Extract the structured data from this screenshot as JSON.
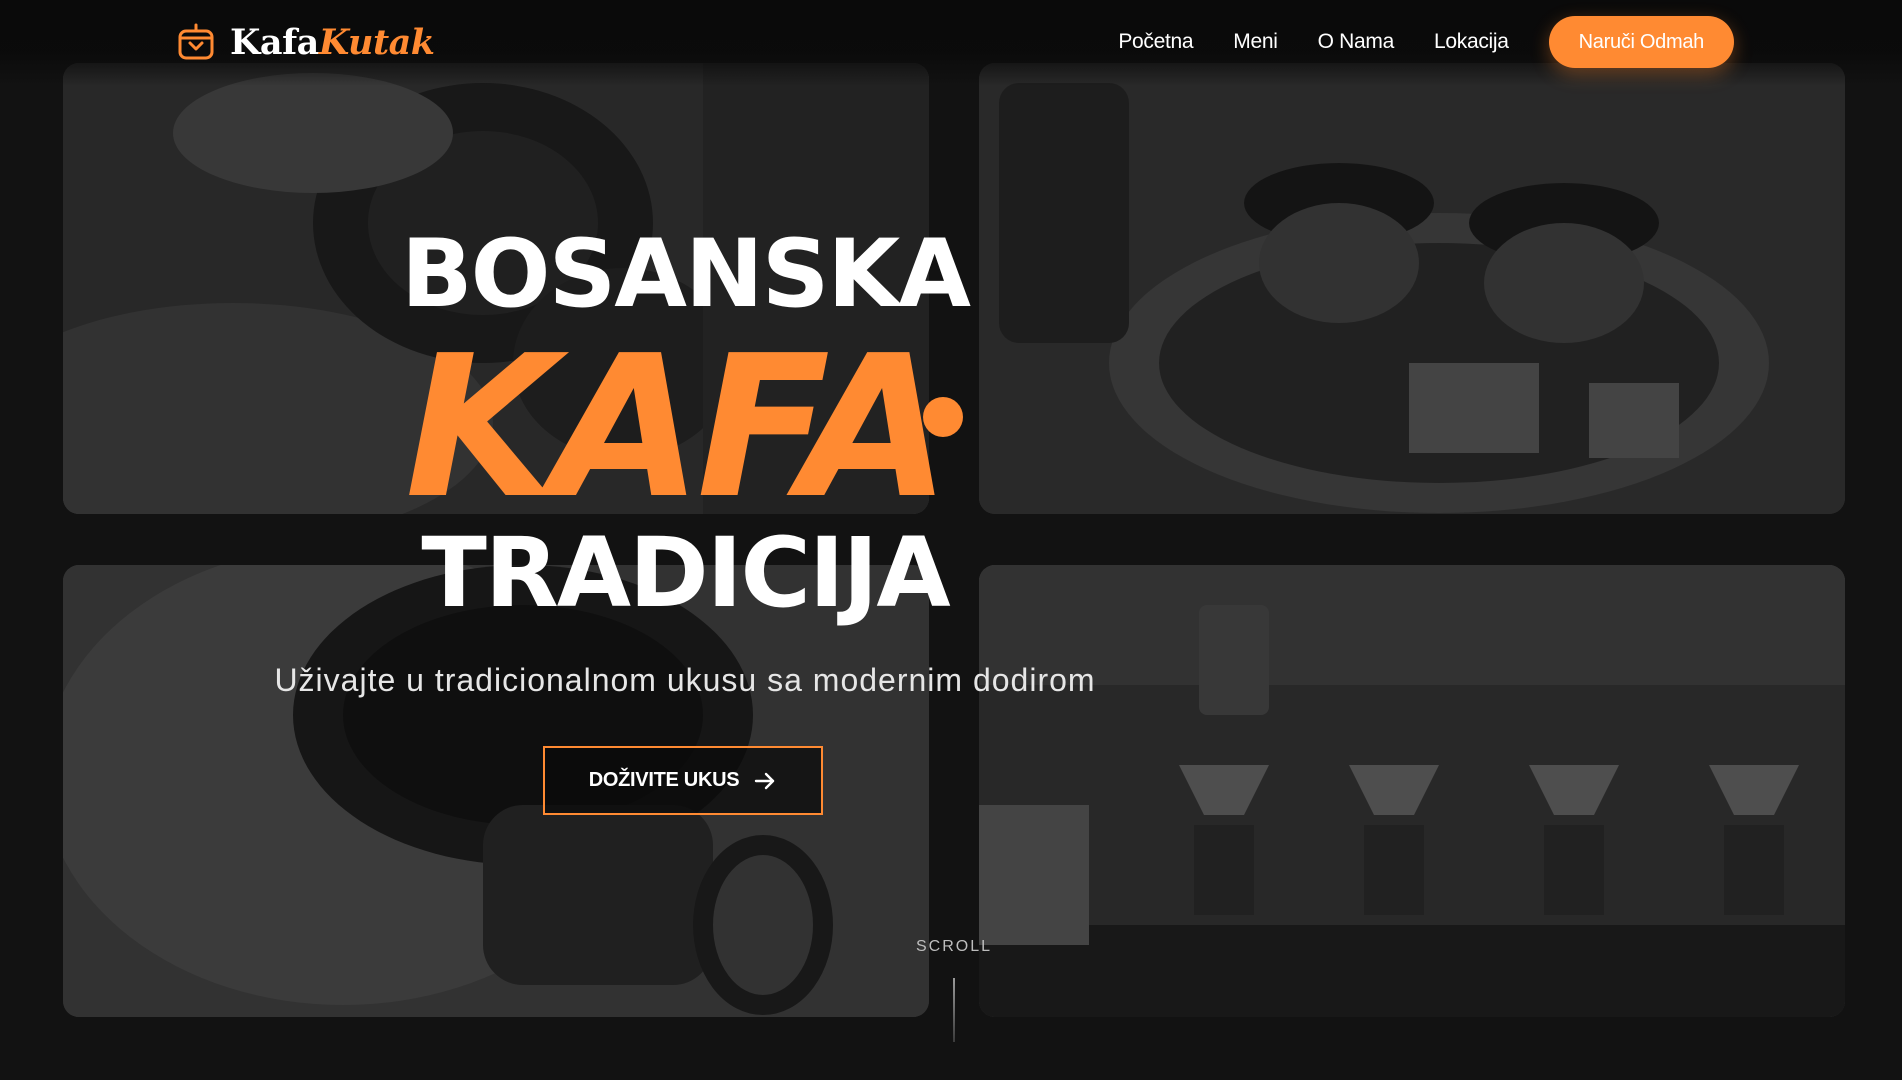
{
  "brand": {
    "name_part1": "Kafa",
    "name_part2": "Kutak",
    "accent_color": "#ff8a32"
  },
  "nav": {
    "links": [
      "Početna",
      "Meni",
      "O Nama",
      "Lokacija"
    ],
    "cta_label": "Naruči Odmah"
  },
  "hero": {
    "line1": "BOSANSKA",
    "line2": "KAFA",
    "line3": "TRADICIJA",
    "subtitle": "Uživajte u tradicionalnom ukusu sa modernim dodirom",
    "cta_label": "DOŽIVITE UKUS",
    "cta_icon": "arrow-right-icon"
  },
  "scroll_label": "SCROLL",
  "background_photos": [
    "coffee-pour-photo",
    "bosnian-coffee-set-photo",
    "coffee-cup-closeup-photo",
    "pour-over-bar-photo"
  ]
}
